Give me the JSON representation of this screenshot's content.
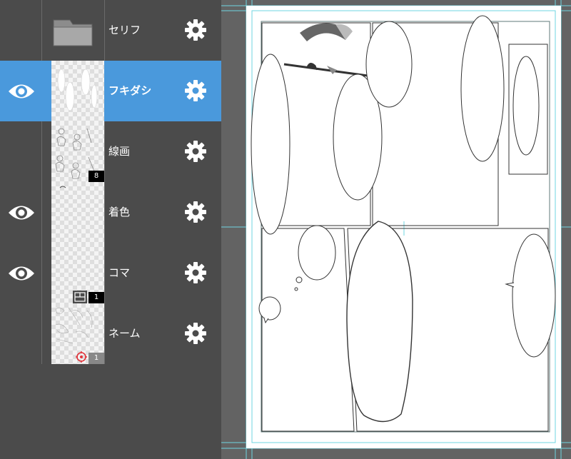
{
  "layers": [
    {
      "name": "セリフ",
      "visible": false,
      "selected": false,
      "type": "folder"
    },
    {
      "name": "フキダシ",
      "visible": true,
      "selected": true,
      "type": "raster"
    },
    {
      "name": "線画",
      "visible": false,
      "selected": false,
      "type": "raster",
      "badge": "8"
    },
    {
      "name": "着色",
      "visible": true,
      "selected": false,
      "type": "raster"
    },
    {
      "name": "コマ",
      "visible": true,
      "selected": false,
      "type": "frame",
      "badge": "1"
    },
    {
      "name": "ネーム",
      "visible": false,
      "selected": false,
      "type": "raster",
      "badge": "1"
    }
  ],
  "colors": {
    "panel_bg": "#4b4b4b",
    "selected": "#4a99dc",
    "canvas_bg": "#636363",
    "guide": "#6fd6e0"
  },
  "icons": {
    "visibility": "eye-icon",
    "settings": "gear-icon",
    "folder": "folder-icon",
    "frame_layer": "frame-layer-icon",
    "reference": "reference-icon"
  }
}
